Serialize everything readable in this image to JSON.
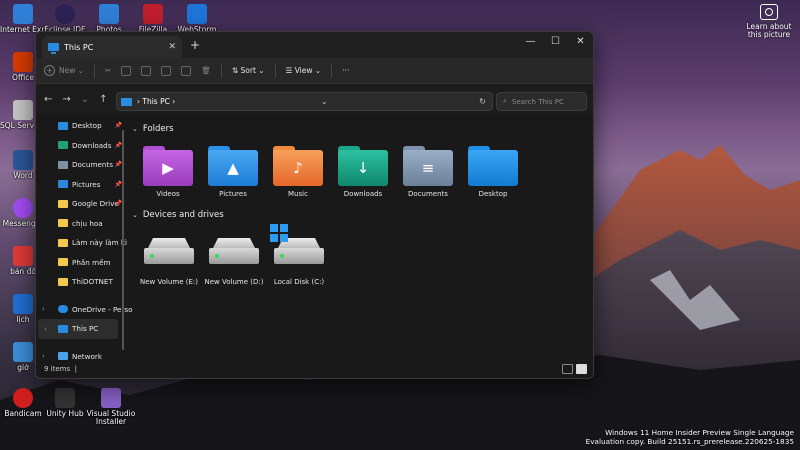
{
  "desktop": {
    "icons_left": [
      {
        "label": "Internet Explorer",
        "color": "#2f7fd6"
      },
      {
        "label": "Office",
        "color": "#d83b01"
      },
      {
        "label": "SQL Server Managem...",
        "color": "#c4c4c4"
      },
      {
        "label": "Word",
        "color": "#2b579a"
      },
      {
        "label": "Messenger",
        "color": "#a14cf2"
      },
      {
        "label": "bản đồ",
        "color": "#e03a3a"
      },
      {
        "label": "lịch",
        "color": "#1f6fd1"
      },
      {
        "label": "giờ",
        "color": "#3c8fd9"
      },
      {
        "label": "Bandicam",
        "color": "#d21f1f"
      }
    ],
    "icons_top": [
      {
        "label": "Eclipse IDE",
        "color": "#2c2255"
      },
      {
        "label": "Photos",
        "color": "#2f7fd6"
      },
      {
        "label": "FileZilla",
        "color": "#bf1e2d"
      },
      {
        "label": "WebStorm",
        "color": "#1e75d8"
      }
    ],
    "icons_bottom": [
      {
        "label": "Unity Hub",
        "color": "#333333"
      },
      {
        "label": "Visual Studio Installer",
        "color": "#8661c5"
      }
    ],
    "learn_label": "Learn about this picture",
    "watermark_line1": "Windows 11 Home Insider Preview Single Language",
    "watermark_line2": "Evaluation copy. Build 25151.rs_prerelease.220625-1835"
  },
  "window": {
    "tab_title": "This PC",
    "new_tab": "+",
    "controls": {
      "minimize": "—",
      "maximize": "☐",
      "close": "✕"
    },
    "toolbar": {
      "new_label": "New",
      "sort_label": "Sort",
      "view_label": "View",
      "more_label": "···"
    },
    "address": {
      "path": "This PC",
      "separator": "›",
      "search_placeholder": "Search This PC"
    },
    "sidebar": [
      {
        "label": "Desktop",
        "color": "#2a8ce0",
        "pinned": true
      },
      {
        "label": "Downloads",
        "color": "#22a079",
        "pinned": true
      },
      {
        "label": "Documents",
        "color": "#7f8fa4",
        "pinned": true
      },
      {
        "label": "Pictures",
        "color": "#2f86e0",
        "pinned": true
      },
      {
        "label": "Google Drive",
        "color": "#f2c94c",
        "pinned": true
      },
      {
        "label": "chịu hoa",
        "color": "#f2c94c",
        "pinned": false
      },
      {
        "label": "Làm này làm kì",
        "color": "#f2c94c",
        "pinned": false
      },
      {
        "label": "Phần mềm",
        "color": "#f2c94c",
        "pinned": false
      },
      {
        "label": "ThiDOTNET",
        "color": "#f2c94c",
        "pinned": false
      }
    ],
    "sidebar_roots": [
      {
        "label": "OneDrive - Perso",
        "color": "#2a8ce0"
      },
      {
        "label": "This PC",
        "color": "#2a8ce0"
      },
      {
        "label": "Network",
        "color": "#4aa3e8"
      }
    ],
    "sections": {
      "folders": "Folders",
      "drives": "Devices and drives"
    },
    "folders": [
      {
        "label": "Videos",
        "color": "#b04fd1",
        "glyph": "▶"
      },
      {
        "label": "Pictures",
        "color": "#2c90e8",
        "glyph": "▲"
      },
      {
        "label": "Music",
        "color": "#f08a3c",
        "glyph": "♪"
      },
      {
        "label": "Downloads",
        "color": "#1aa68a",
        "glyph": "↓"
      },
      {
        "label": "Documents",
        "color": "#7f93ad",
        "glyph": "≡"
      },
      {
        "label": "Desktop",
        "color": "#1e8fe6",
        "glyph": ""
      }
    ],
    "drives": [
      {
        "label": "New Volume (E:)"
      },
      {
        "label": "New Volume (D:)"
      },
      {
        "label": "Local Disk (C:)"
      }
    ],
    "status": {
      "items": "9 items",
      "cursor": "|"
    }
  }
}
